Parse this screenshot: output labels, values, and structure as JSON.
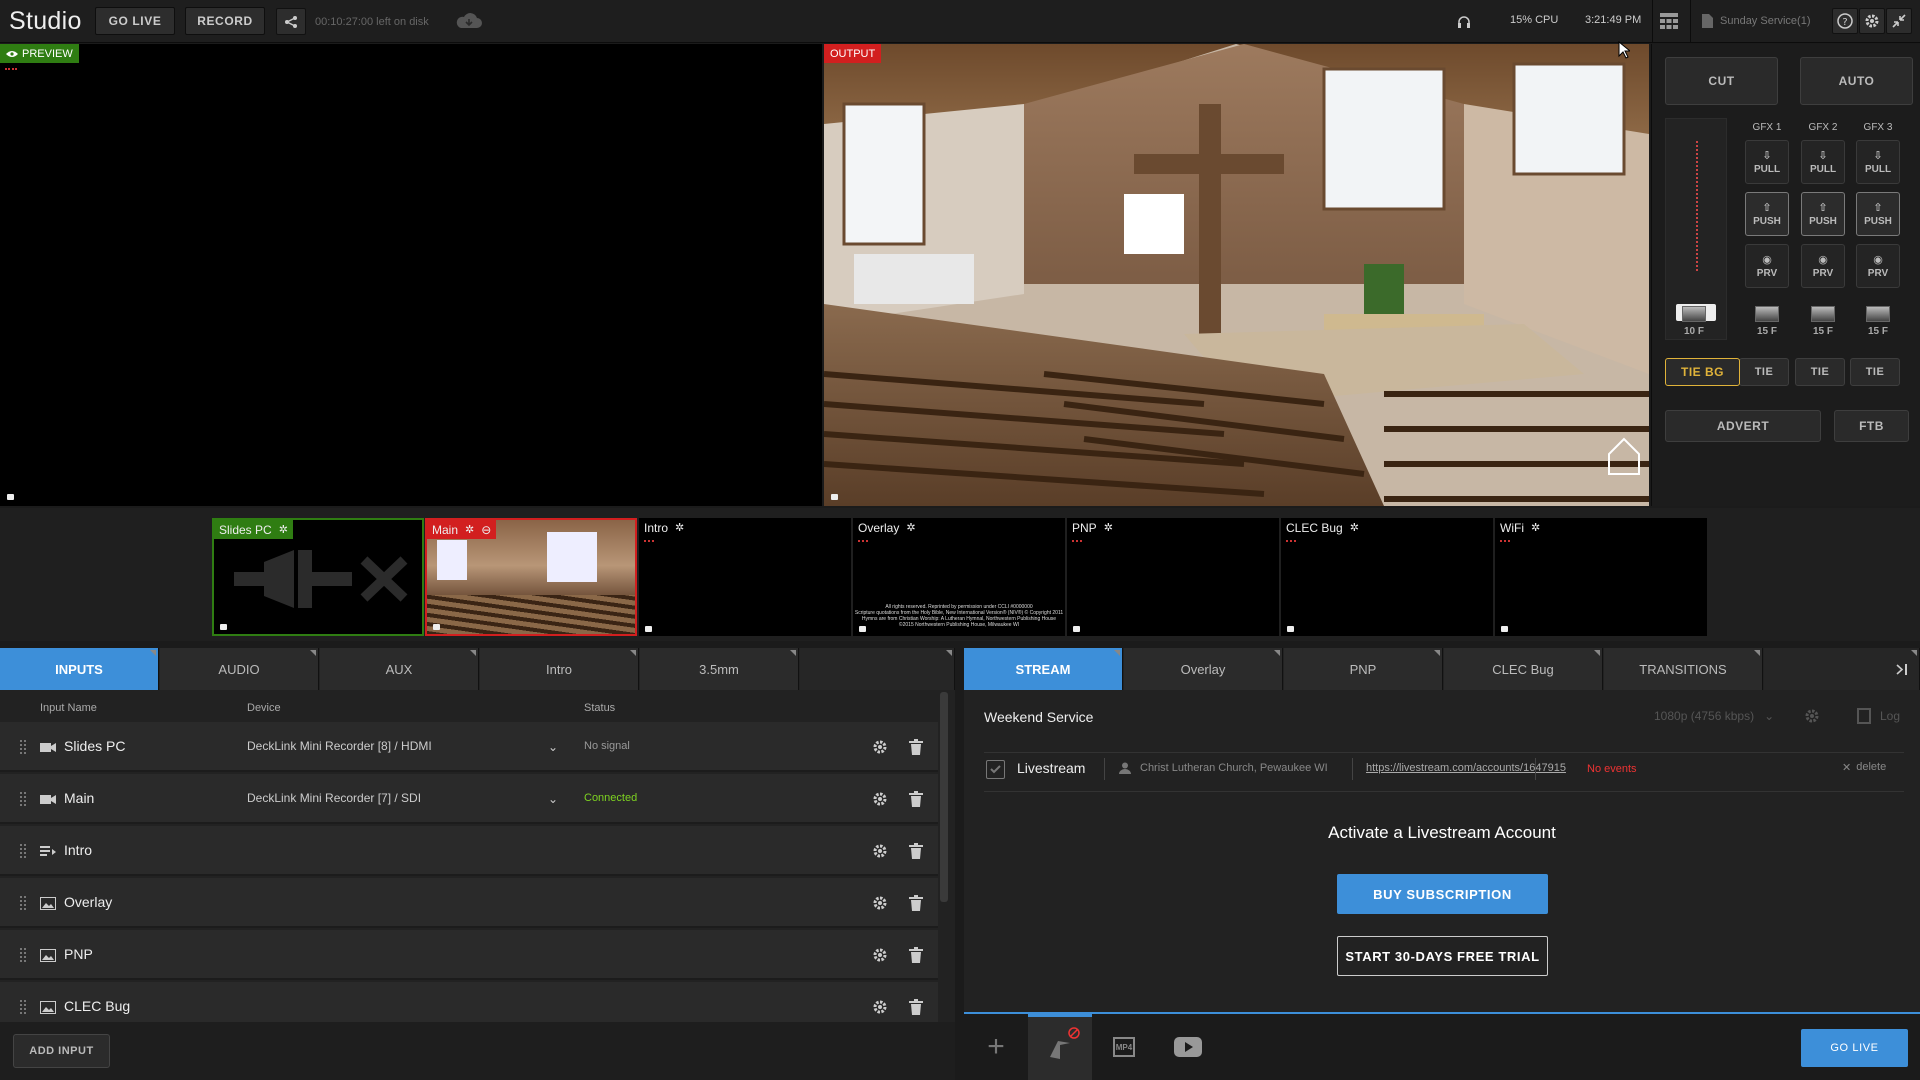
{
  "app": {
    "title": "Studio"
  },
  "topbar": {
    "go_live": "GO LIVE",
    "record": "RECORD",
    "disk": "00:10:27:00 left on disk",
    "cpu": "15% CPU",
    "time": "3:21:49 PM",
    "project": "Sunday Service(1)"
  },
  "preview": {
    "label": "PREVIEW"
  },
  "output": {
    "label": "OUTPUT"
  },
  "controls": {
    "cut": "CUT",
    "auto": "AUTO",
    "gfx": [
      {
        "name": "GFX 1",
        "pull": "PULL",
        "push": "PUSH",
        "prv": "PRV",
        "frames": "15 F",
        "tie": "TIE"
      },
      {
        "name": "GFX 2",
        "pull": "PULL",
        "push": "PUSH",
        "prv": "PRV",
        "frames": "15 F",
        "tie": "TIE"
      },
      {
        "name": "GFX 3",
        "pull": "PULL",
        "push": "PUSH",
        "prv": "PRV",
        "frames": "15 F",
        "tie": "TIE"
      }
    ],
    "bg_frames": "10 F",
    "tie_bg": "TIE BG",
    "advert": "ADVERT",
    "ftb": "FTB"
  },
  "thumbnails": [
    {
      "label": "Slides PC",
      "state": "preview"
    },
    {
      "label": "Main",
      "state": "program"
    },
    {
      "label": "Intro",
      "state": "idle"
    },
    {
      "label": "Overlay",
      "state": "idle"
    },
    {
      "label": "PNP",
      "state": "idle"
    },
    {
      "label": "CLEC Bug",
      "state": "idle"
    },
    {
      "label": "WiFi",
      "state": "idle"
    }
  ],
  "overlay_text": {
    "line1": "All rights reserved. Reprinted by permission under CCLI #0000000",
    "line2": "Scripture quotations from the Holy Bible, New International Version® (NIV®) © Copyright 2011",
    "line3": "Hymns are from Christian Worship: A Lutheran Hymnal, Northwestern Publishing House",
    "line4": "©2015 Northwestern Publishing House, Milwaukee WI"
  },
  "left_tabs": [
    "INPUTS",
    "AUDIO",
    "AUX",
    "Intro",
    "3.5mm"
  ],
  "inputs_table": {
    "headers": {
      "name": "Input Name",
      "device": "Device",
      "status": "Status"
    },
    "rows": [
      {
        "name": "Slides PC",
        "icon": "camera-icon",
        "device": "DeckLink Mini Recorder [8] / HDMI",
        "status": "No signal"
      },
      {
        "name": "Main",
        "icon": "camera-icon",
        "device": "DeckLink Mini Recorder [7] / SDI",
        "status": "Connected"
      },
      {
        "name": "Intro",
        "icon": "playlist-icon",
        "device": "",
        "status": ""
      },
      {
        "name": "Overlay",
        "icon": "image-icon",
        "device": "",
        "status": ""
      },
      {
        "name": "PNP",
        "icon": "image-icon",
        "device": "",
        "status": ""
      },
      {
        "name": "CLEC Bug",
        "icon": "image-icon",
        "device": "",
        "status": ""
      }
    ],
    "add_input": "ADD INPUT"
  },
  "right_tabs": [
    "STREAM",
    "Overlay",
    "PNP",
    "CLEC Bug",
    "TRANSITIONS"
  ],
  "stream": {
    "name": "Weekend Service",
    "quality": "1080p (4756 kbps)",
    "log": "Log",
    "dest_name": "Livestream",
    "account": "Christ Lutheran Church, Pewaukee WI",
    "url": "https://livestream.com/accounts/1647915",
    "events": "No events",
    "delete": "delete",
    "activate_title": "Activate a Livestream Account",
    "buy": "BUY SUBSCRIPTION",
    "trial": "START 30-DAYS FREE TRIAL",
    "go_live": "GO LIVE",
    "mp4": "MP4"
  },
  "colors": {
    "accent": "#3d8fd9",
    "preview_green": "#2f7d12",
    "program_red": "#d21f1f",
    "tie_yellow": "#e0b33a",
    "status_green": "#7ed321"
  }
}
